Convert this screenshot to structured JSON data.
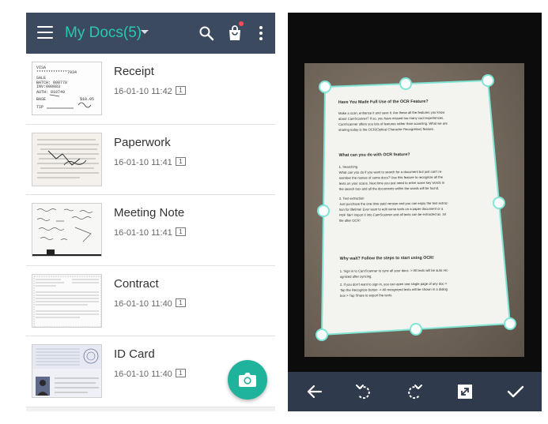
{
  "left_screen": {
    "app_bar": {
      "title": "My Docs(5)",
      "icons": [
        "menu-icon",
        "chevron-down-icon",
        "search-icon",
        "shopping-bag-icon",
        "more-vert-icon"
      ],
      "accent_color": "#28c8b2",
      "bar_color": "#3b4a5e",
      "notification_dot_color": "#ff4d57"
    },
    "documents": [
      {
        "name": "Receipt",
        "date": "16-01-10 11:42",
        "pages": "1"
      },
      {
        "name": "Paperwork",
        "date": "16-01-10 11:41",
        "pages": "1"
      },
      {
        "name": "Meeting Note",
        "date": "16-01-10 11:41",
        "pages": "1"
      },
      {
        "name": "Contract",
        "date": "16-01-10 11:40",
        "pages": "1"
      },
      {
        "name": "ID Card",
        "date": "16-01-10 11:40",
        "pages": "1"
      }
    ],
    "receipt_thumb": {
      "lines": [
        "VISA",
        "*************7934",
        "SALE",
        "BATCH: 000778",
        "INV:000083",
        "AUTH: 018749",
        "BASE",
        "TIP"
      ],
      "amount": "$18.05"
    },
    "fab": {
      "icon": "camera-icon",
      "color": "#1fb39c"
    }
  },
  "right_screen": {
    "document": {
      "heading1": "Have You Made Full Use of the OCR Feature?",
      "intro": [
        "Make a scan, enhance it and save it. Are these all the features you know",
        "about CamScanner? If so, you have missed too many cool experiences.",
        "CamScanner offers you lots of features rather than scanning. What we are",
        "sharing today is the OCR(Optical Character Recognition) feature."
      ],
      "heading2": "What can you do with OCR feature?",
      "section1": [
        "1.  Searching",
        "What can you do if you want to search for a document but just can't re-",
        "member the names of some docs? Use this feature to recognize all the",
        "texts on your scans. Next time you just need to enter some key words in",
        "the search box and all the documents within the words will be found.",
        "2.  Text extraction",
        "Just purchase the one-time paid version and you can enjoy the text extrac-",
        "tion for lifetime! Ever want to edit some texts on a paper document or a",
        "PDF file? Import it into CamScanner and all texts can be extracted as .txt",
        "file after OCR!"
      ],
      "heading3": "Why wait? Follow the steps to start using OCR!",
      "section2": [
        "1.  Sign in to CamScanner to sync all your docs -> All texts will be auto rec-",
        "ognized after syncing.",
        "2.  If you don't want to sign in, you can open one single page of any doc->",
        "Tap the Recognize button -> All recognized texts will be shown in a dialog",
        "box-> Tap Share to export the texts."
      ]
    },
    "crop_color": "#7fe6d6",
    "toolbar": {
      "icons": [
        "back-arrow-icon",
        "rotate-left-icon",
        "rotate-right-icon",
        "expand-icon",
        "checkmark-icon"
      ],
      "bar_color": "#2f3b4c"
    }
  }
}
